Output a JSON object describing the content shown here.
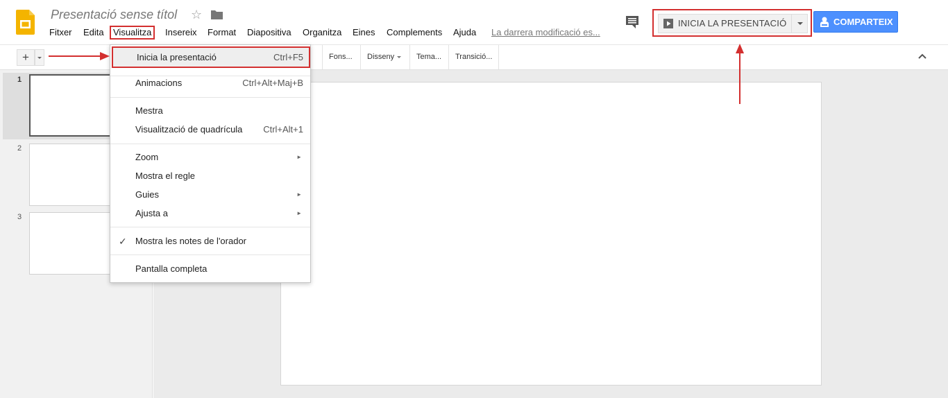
{
  "header": {
    "doc_title": "Presentació sense títol",
    "menu": [
      "Fitxer",
      "Edita",
      "Visualitza",
      "Insereix",
      "Format",
      "Diapositiva",
      "Organitza",
      "Eines",
      "Complements",
      "Ajuda"
    ],
    "last_edit": "La darrera modificació es...",
    "present_label": "INICIA LA PRESENTACIÓ",
    "share_label": "COMPARTEIX",
    "logo_icon": "google-slides-icon",
    "accent": "#4d90fe",
    "highlight": "#d32f2f"
  },
  "toolbar": {
    "add_label": "+",
    "buttons": [
      "Fons...",
      "Disseny",
      "Tema...",
      "Transició..."
    ]
  },
  "filmstrip": {
    "slides": [
      "1",
      "2",
      "3"
    ]
  },
  "view_menu": {
    "items": [
      {
        "label": "Inicia la presentació",
        "shortcut": "Ctrl+F5"
      },
      {
        "label": "Animacions",
        "shortcut": "Ctrl+Alt+Maj+B"
      },
      {
        "label": "Mestra",
        "shortcut": ""
      },
      {
        "label": "Visualització de quadrícula",
        "shortcut": "Ctrl+Alt+1"
      },
      {
        "label": "Zoom",
        "shortcut": ""
      },
      {
        "label": "Mostra el regle",
        "shortcut": ""
      },
      {
        "label": "Guies",
        "shortcut": ""
      },
      {
        "label": "Ajusta a",
        "shortcut": ""
      },
      {
        "label": "Mostra les notes de l'orador",
        "shortcut": ""
      },
      {
        "label": "Pantalla completa",
        "shortcut": ""
      }
    ],
    "submenu_glyph": "►",
    "check_glyph": "✓"
  }
}
